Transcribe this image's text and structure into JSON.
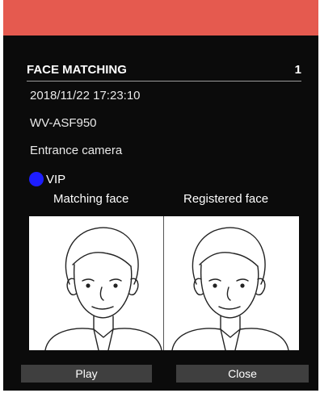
{
  "dialog": {
    "title": "FACE MATCHING",
    "count": "1",
    "datetime": "2018/11/22 17:23:10",
    "camera_model": "WV-ASF950",
    "camera_name": "Entrance camera",
    "category": {
      "label": "VIP",
      "color": "#1d1dff"
    },
    "matching_caption": "Matching face",
    "registered_caption": "Registered face"
  },
  "buttons": {
    "play": "Play",
    "close": "Close"
  },
  "colors": {
    "titlebar": "#e55a4f",
    "panel": "#0b0b0b",
    "button": "#3f3f3f"
  }
}
